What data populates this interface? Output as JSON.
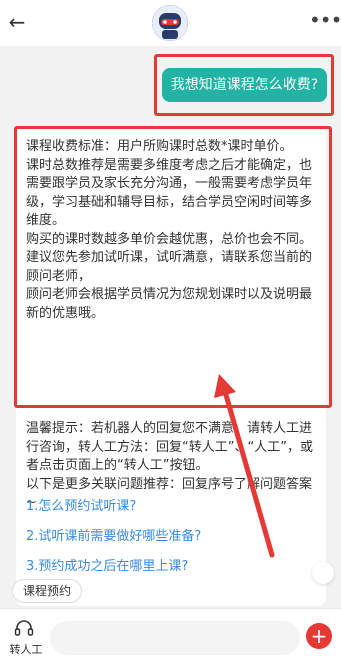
{
  "header": {
    "back_icon": "arrow-left-icon",
    "avatar_icon": "robot-avatar-icon",
    "more_icon": "more-dots-icon"
  },
  "chat": {
    "user_message": "我想知道课程怎么收费?",
    "bot_message_lines": [
      "课程收费标准：用户所购课时总数*课时单价。",
      "课时总数推荐是需要多维度考虑之后才能确定，也需要跟学员及家长充分沟通，一般需要考虑学员年级，学习基础和辅导目标，结合学员空闲时间等多维度。",
      "购买的课时数越多单价会越优惠，总价也会不同。",
      "建议您先参加试听课，试听满意，请联系您当前的顾问老师，",
      "顾问老师会根据学员情况为您规划课时以及说明最新的优惠哦。"
    ],
    "tip_lines": [
      "温馨提示：若机器人的回复您不满意，请转人工进行咨询，转人工方法：回复“转人工”、“人工”，或者点击页面上的“转人工”按钮。",
      "以下是更多关联问题推荐：回复序号了解问题答案~"
    ],
    "questions": [
      "1.怎么预约试听课?",
      "2.试听课前需要做好哪些准备?",
      "3.预约成功之后在哪里上课?"
    ]
  },
  "quick_reply": {
    "label": "课程预约"
  },
  "bottom": {
    "agent_label": "转人工",
    "agent_icon": "headset-icon",
    "plus_icon": "plus-icon",
    "accent_color": "#e53935",
    "bubble_color": "#22b3a4",
    "link_color": "#3a8be0"
  }
}
